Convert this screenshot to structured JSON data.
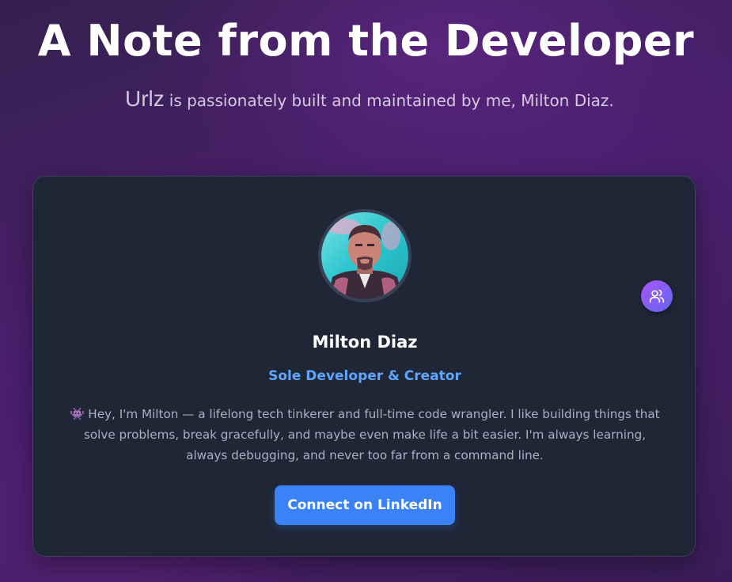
{
  "header": {
    "title": "A Note from the Developer",
    "brand": "Urlz",
    "subtitle": "is passionately built and maintained by me, Milton Diaz."
  },
  "card": {
    "name": "Milton Diaz",
    "role": "Sole Developer & Creator",
    "bio_emoji": "👾",
    "bio": "Hey, I'm Milton — a lifelong tech tinkerer and full-time code wrangler. I like building things that solve problems, break gracefully, and maybe even make life a bit easier. I'm always learning, always debugging, and never too far from a command line.",
    "cta_label": "Connect on LinkedIn",
    "badge_icon": "users-icon",
    "avatar_icon": "profile-photo"
  },
  "colors": {
    "background": "#4a1f6e",
    "card": "#1f2737",
    "accent": "#3b82f6",
    "role_text": "#60a5fa",
    "badge_gradient_start": "#a855f7",
    "badge_gradient_end": "#6366f1"
  }
}
